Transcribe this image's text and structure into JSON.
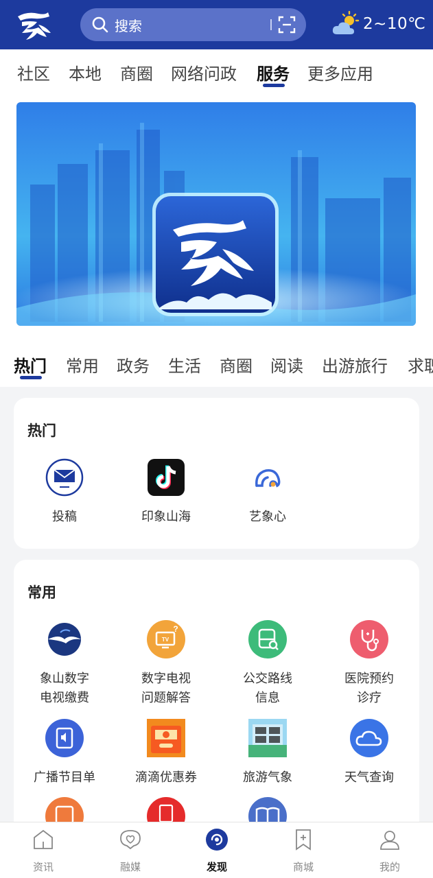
{
  "header": {
    "search_placeholder": "搜索",
    "weather_text": "2~10℃"
  },
  "top_tabs": [
    "社区",
    "本地",
    "商圈",
    "网络问政",
    "服务",
    "更多应用"
  ],
  "top_tabs_active": "服务",
  "category_tabs": [
    "热门",
    "常用",
    "政务",
    "生活",
    "商圈",
    "阅读",
    "出游旅行",
    "求职"
  ],
  "category_active": "热门",
  "sections": {
    "hot": {
      "title": "热门",
      "apps": [
        {
          "label": "投稿",
          "icon": "mail-envelope-icon"
        },
        {
          "label": "印象山海",
          "icon": "tiktok-icon"
        },
        {
          "label": "艺象心",
          "icon": "elephant-icon"
        }
      ]
    },
    "common": {
      "title": "常用",
      "apps": [
        {
          "label_lines": [
            "象山数字",
            "电视缴费"
          ],
          "icon": "bird-globe-icon"
        },
        {
          "label_lines": [
            "数字电视",
            "问题解答"
          ],
          "icon": "tv-question-icon"
        },
        {
          "label_lines": [
            "公交路线",
            "信息"
          ],
          "icon": "bus-search-icon"
        },
        {
          "label_lines": [
            "医院预约",
            "诊疗"
          ],
          "icon": "stethoscope-icon"
        },
        {
          "label_lines": [
            "广播节目单"
          ],
          "icon": "radio-schedule-icon"
        },
        {
          "label_lines": [
            "滴滴优惠券"
          ],
          "icon": "coupon-icon"
        },
        {
          "label_lines": [
            "旅游气象"
          ],
          "icon": "travel-weather-icon"
        },
        {
          "label_lines": [
            "天气查询"
          ],
          "icon": "cloud-icon"
        }
      ]
    }
  },
  "bottom_nav": [
    {
      "label": "资讯",
      "icon": "home-icon"
    },
    {
      "label": "融媒",
      "icon": "heart-bubble-icon"
    },
    {
      "label": "发现",
      "icon": "discover-icon"
    },
    {
      "label": "商城",
      "icon": "bookmark-plus-icon"
    },
    {
      "label": "我的",
      "icon": "user-icon"
    }
  ],
  "bottom_nav_active": "发现",
  "colors": {
    "brand_blue": "#1d3a9e",
    "search_bg": "#5b72c9"
  }
}
